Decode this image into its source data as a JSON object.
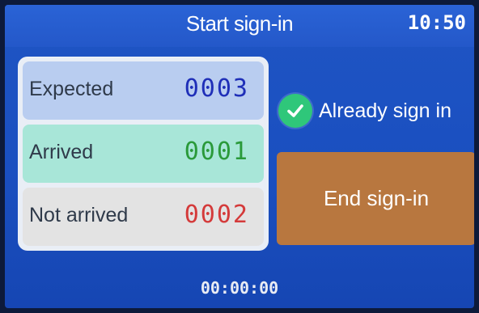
{
  "header": {
    "title": "Start sign-in",
    "time": "10:50"
  },
  "counts": {
    "expected": {
      "label": "Expected",
      "value": "0003",
      "color": "#1f2fb8"
    },
    "arrived": {
      "label": "Arrived",
      "value": "0001",
      "color": "#2a9a3a"
    },
    "not_arrived": {
      "label": "Not arrived",
      "value": "0002",
      "color": "#d43a3a"
    }
  },
  "status": {
    "icon": "check-circle-icon",
    "text": "Already sign in",
    "icon_color": "#2fc77a"
  },
  "actions": {
    "end_label": "End sign-in",
    "end_color": "#b8773f"
  },
  "footer": {
    "elapsed": "00:00:00"
  }
}
